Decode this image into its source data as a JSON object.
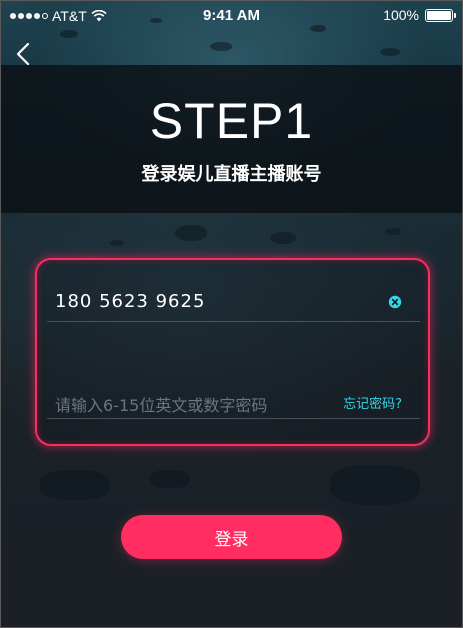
{
  "status_bar": {
    "carrier": "AT&T",
    "time": "9:41 AM",
    "battery": "100%",
    "signal_icon": "signal-dots-icon",
    "wifi_icon": "wifi-icon",
    "battery_icon": "battery-icon"
  },
  "header": {
    "back_icon": "chevron-left-icon",
    "title": "STEP1",
    "subtitle": "登录娱儿直播主播账号"
  },
  "form": {
    "phone_value": "180 5623 9625",
    "clear_icon": "clear-circle-icon",
    "password_placeholder": "请输入6-15位英文或数字密码",
    "forgot_label": "忘记密码?"
  },
  "login_button": {
    "label": "登录"
  },
  "colors": {
    "accent": "#ff2d62",
    "link": "#35d6e6",
    "background": "#1b1f26"
  }
}
